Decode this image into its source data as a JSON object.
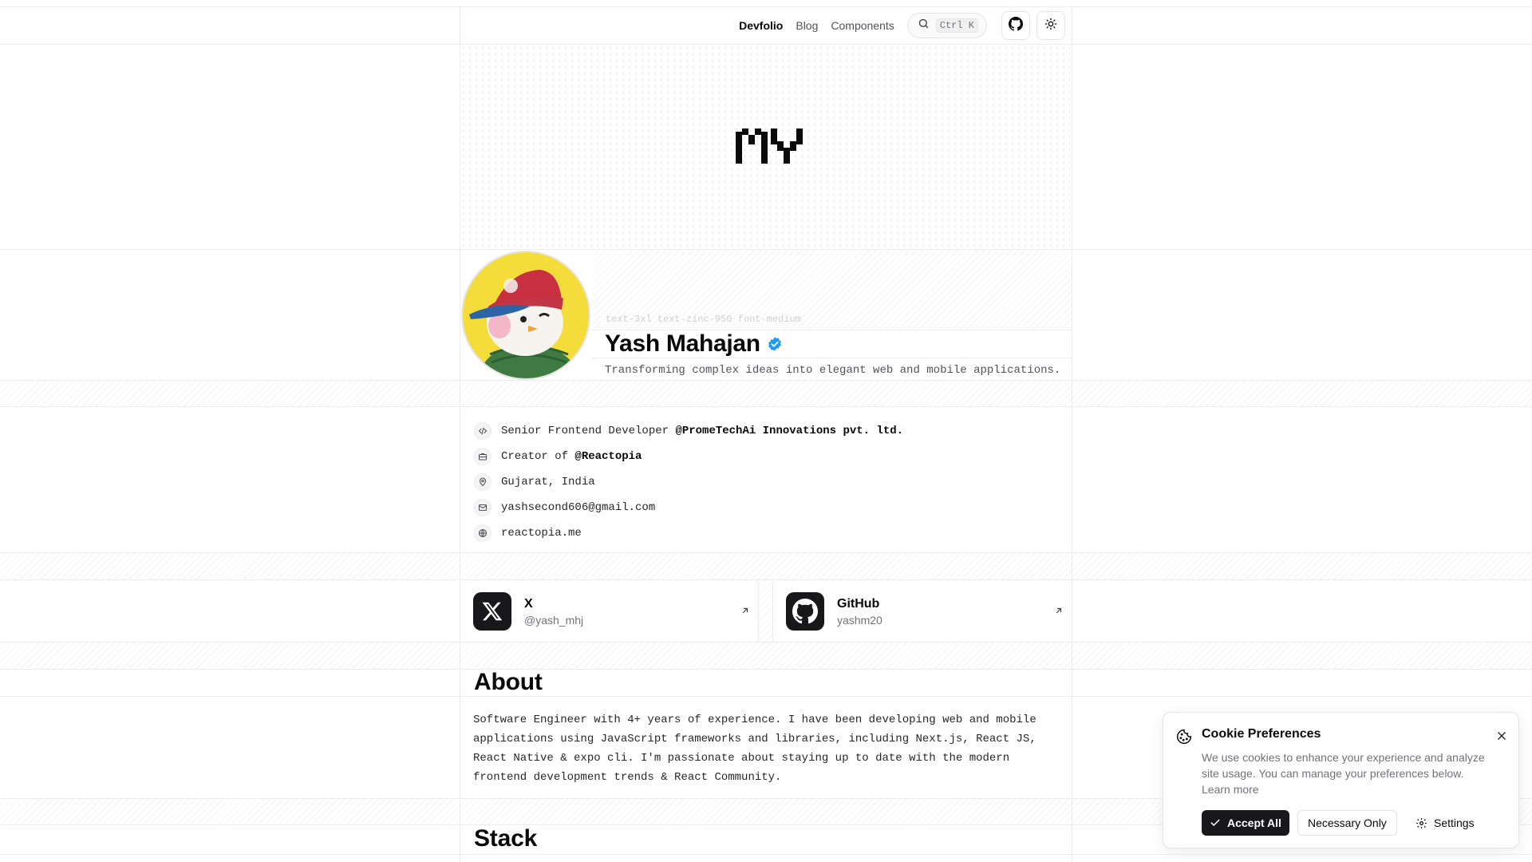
{
  "header": {
    "nav": [
      {
        "label": "Devfolio"
      },
      {
        "label": "Blog"
      },
      {
        "label": "Components"
      }
    ],
    "search_shortcut": "Ctrl K",
    "github_icon": "github-icon",
    "theme_icon": "sun-icon"
  },
  "hero": {
    "logo_text": "MY"
  },
  "profile": {
    "css_note": "text-3xl text-zinc-950 font-medium",
    "name": "Yash Mahajan",
    "tagline": "Transforming complex ideas into elegant web and mobile applications.",
    "verified_color": "#1d9bf0"
  },
  "info": {
    "role_prefix": "Senior Frontend Developer ",
    "role_company": "@PromeTechAi Innovations pvt. ltd.",
    "creator_prefix": "Creator of ",
    "creator_link": "@Reactopia",
    "location": "Gujarat, India",
    "email": "yashsecond606@gmail.com",
    "website": "reactopia.me"
  },
  "social": [
    {
      "title": "X",
      "handle": "@yash_mhj"
    },
    {
      "title": "GitHub",
      "handle": "yashm20"
    }
  ],
  "about": {
    "heading": "About",
    "text": "Software Engineer with 4+ years of experience. I have been developing web and mobile applications using JavaScript frameworks and libraries, including Next.js, React JS, React Native & expo cli. I'm passionate about staying up to date with the modern frontend development trends & React Community."
  },
  "stack": {
    "heading": "Stack"
  },
  "cookie": {
    "title": "Cookie Preferences",
    "body": "We use cookies to enhance your experience and analyze site usage. You can manage your preferences below.",
    "learn_more": "Learn more",
    "accept": "Accept All",
    "necessary": "Necessary Only",
    "settings": "Settings"
  }
}
